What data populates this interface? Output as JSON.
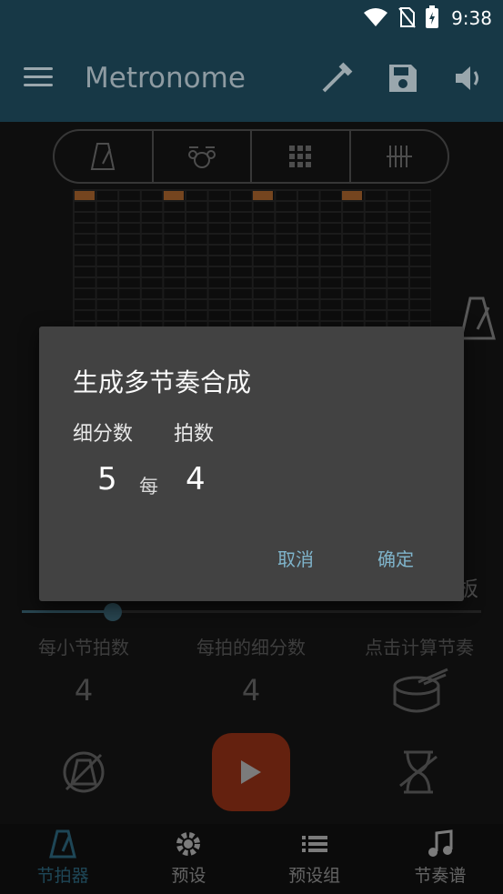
{
  "status": {
    "time": "9:38"
  },
  "appbar": {
    "title": "Metronome"
  },
  "partial_text": "板",
  "columns": [
    {
      "label": "每小节拍数",
      "value": "4"
    },
    {
      "label": "每拍的细分数",
      "value": "4"
    },
    {
      "label": "点击计算节奏"
    }
  ],
  "dialog": {
    "title": "生成多节奏合成",
    "subdivision_label": "细分数",
    "beats_label": "拍数",
    "subdivision_value": "5",
    "each": "每",
    "beats_value": "4",
    "cancel": "取消",
    "confirm": "确定"
  },
  "nav": [
    {
      "label": "节拍器",
      "icon": "metronome-icon",
      "active": true
    },
    {
      "label": "预设",
      "icon": "gear-icon"
    },
    {
      "label": "预设组",
      "icon": "list-icon"
    },
    {
      "label": "节奏谱",
      "icon": "music-note-icon"
    }
  ],
  "colors": {
    "appbar": "#173846",
    "accent": "#b46a30",
    "play": "#9a3418",
    "dialog_button": "#7fb4cb",
    "nav_active": "#2f6c84"
  }
}
